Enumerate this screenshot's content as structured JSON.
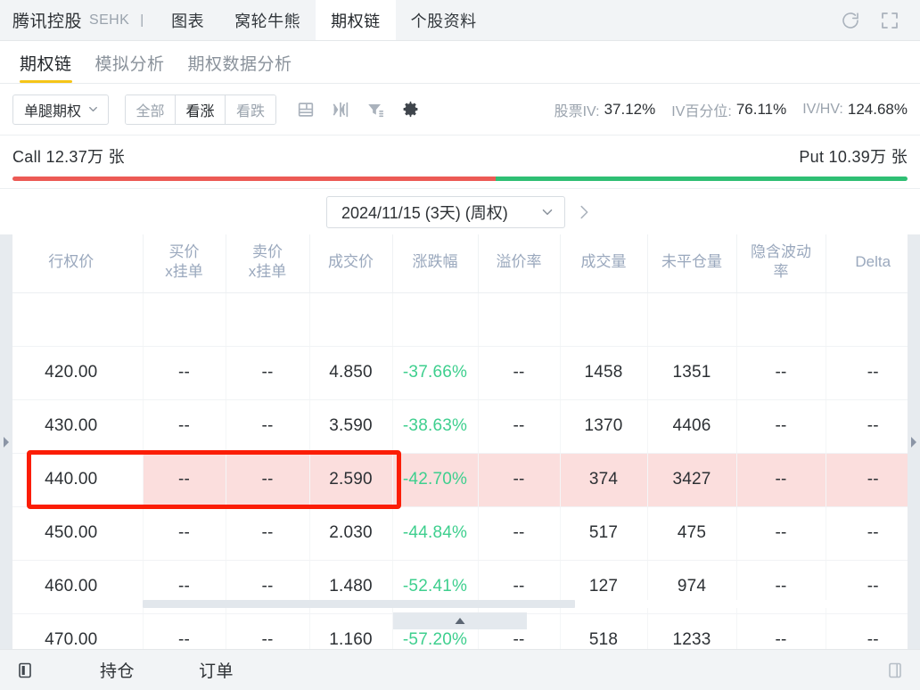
{
  "header": {
    "symbol_name": "腾讯控股",
    "market": "SEHK",
    "divider": "|",
    "nav": [
      {
        "label": "图表",
        "active": false
      },
      {
        "label": "窝轮牛熊",
        "active": false
      },
      {
        "label": "期权链",
        "active": true
      },
      {
        "label": "个股资料",
        "active": false
      }
    ],
    "refresh_icon": "refresh-icon",
    "fullscreen_icon": "fullscreen-icon"
  },
  "subtabs": [
    {
      "label": "期权链",
      "active": true
    },
    {
      "label": "模拟分析",
      "active": false
    },
    {
      "label": "期权数据分析",
      "active": false
    }
  ],
  "toolbar": {
    "strategy_dropdown": "单腿期权",
    "segments": [
      {
        "label": "全部",
        "active": false
      },
      {
        "label": "看涨",
        "active": true
      },
      {
        "label": "看跌",
        "active": false
      }
    ],
    "icons": [
      "layout-rows-icon",
      "collapse-horizontal-icon",
      "filter-icon",
      "settings-gear-icon"
    ],
    "stats": [
      {
        "label": "股票IV:",
        "value": "37.12%"
      },
      {
        "label": "IV百分位:",
        "value": "76.11%"
      },
      {
        "label": "IV/HV:",
        "value": "124.68%"
      }
    ]
  },
  "volume_bar": {
    "call_label": "Call 12.37万 张",
    "put_label": "Put 10.39万 张",
    "call_pct": 54,
    "put_pct": 46,
    "call_color": "#ec5a55",
    "put_color": "#2fbf74"
  },
  "date_selector": {
    "value": "2024/11/15 (3天) (周权)",
    "chevron_icon": "chevron-down-icon",
    "next_icon": "chevron-right-icon"
  },
  "table": {
    "headers": [
      {
        "line1": "行权价",
        "line2": ""
      },
      {
        "line1": "买价",
        "line2": "x挂单"
      },
      {
        "line1": "卖价",
        "line2": "x挂单"
      },
      {
        "line1": "成交价",
        "line2": ""
      },
      {
        "line1": "涨跌幅",
        "line2": ""
      },
      {
        "line1": "溢价率",
        "line2": ""
      },
      {
        "line1": "成交量",
        "line2": ""
      },
      {
        "line1": "未平仓量",
        "line2": ""
      },
      {
        "line1": "隐含波动率",
        "line2": ""
      },
      {
        "line1": "Delta",
        "line2": ""
      }
    ],
    "rows": [
      {
        "strike": "420.00",
        "bid": "--",
        "ask": "--",
        "last": "4.850",
        "change": "-37.66%",
        "premium": "--",
        "volume": "1458",
        "open_interest": "1351",
        "iv": "--",
        "delta": "--",
        "highlighted": false
      },
      {
        "strike": "430.00",
        "bid": "--",
        "ask": "--",
        "last": "3.590",
        "change": "-38.63%",
        "premium": "--",
        "volume": "1370",
        "open_interest": "4406",
        "iv": "--",
        "delta": "--",
        "highlighted": false
      },
      {
        "strike": "440.00",
        "bid": "--",
        "ask": "--",
        "last": "2.590",
        "change": "-42.70%",
        "premium": "--",
        "volume": "374",
        "open_interest": "3427",
        "iv": "--",
        "delta": "--",
        "highlighted": true
      },
      {
        "strike": "450.00",
        "bid": "--",
        "ask": "--",
        "last": "2.030",
        "change": "-44.84%",
        "premium": "--",
        "volume": "517",
        "open_interest": "475",
        "iv": "--",
        "delta": "--",
        "highlighted": false
      },
      {
        "strike": "460.00",
        "bid": "--",
        "ask": "--",
        "last": "1.480",
        "change": "-52.41%",
        "premium": "--",
        "volume": "127",
        "open_interest": "974",
        "iv": "--",
        "delta": "--",
        "highlighted": false
      },
      {
        "strike": "470.00",
        "bid": "--",
        "ask": "--",
        "last": "1.160",
        "change": "-57.20%",
        "premium": "--",
        "volume": "518",
        "open_interest": "1233",
        "iv": "--",
        "delta": "--",
        "highlighted": false
      }
    ],
    "negative_color": "#3ecf8e",
    "highlight_row_color": "#fbdedd",
    "annotation_color": "#fb1d05"
  },
  "side_gutters": {
    "left_icon": "expand-right-icon",
    "right_icon": "expand-right-icon"
  },
  "footer": {
    "panel_toggle_icon": "panel-left-icon",
    "items": [
      {
        "label": "持仓"
      },
      {
        "label": "订单"
      }
    ],
    "right_icon": "panel-right-icon",
    "collapse_icon": "chevron-up-icon"
  }
}
